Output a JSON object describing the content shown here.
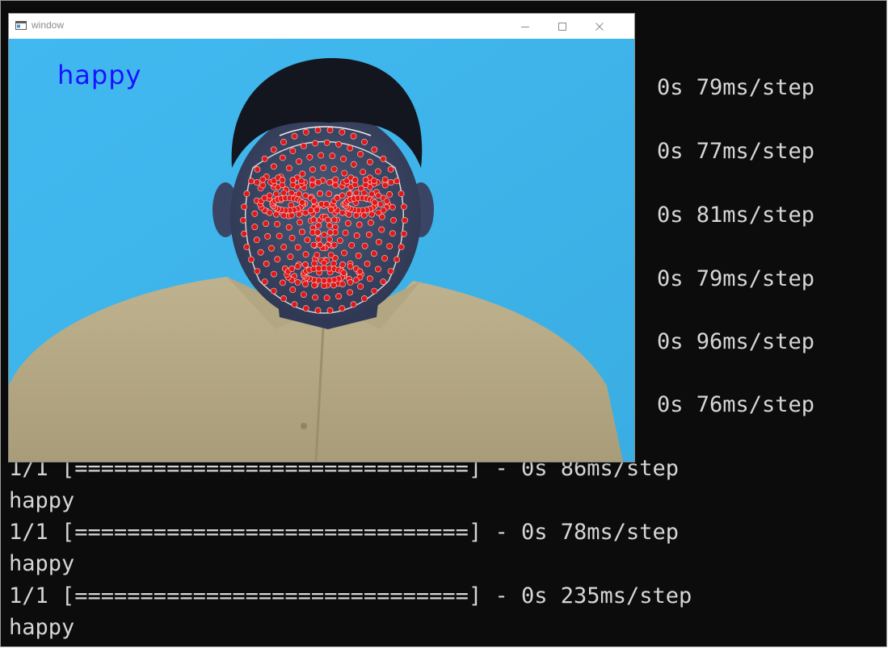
{
  "window": {
    "title": "window",
    "emotion_label": "happy"
  },
  "console": {
    "partial_lines": [
      "0s 79ms/step",
      "0s 77ms/step",
      "0s 81ms/step",
      "0s 79ms/step",
      "0s 96ms/step",
      "0s 76ms/step"
    ],
    "full_lines": [
      "1/1 [==============================] - 0s 86ms/step",
      "happy",
      "1/1 [==============================] - 0s 78ms/step",
      "happy",
      "1/1 [==============================] - 0s 235ms/step",
      "happy"
    ]
  },
  "colors": {
    "background_blue": "#3fb8ee",
    "landmark_red": "#e01818",
    "label_blue": "#1a12ff",
    "console_bg": "#0c0c0c",
    "console_text": "#d6d6d6"
  },
  "icons": [
    "app-window-icon",
    "minimize-icon",
    "maximize-icon",
    "close-icon"
  ]
}
